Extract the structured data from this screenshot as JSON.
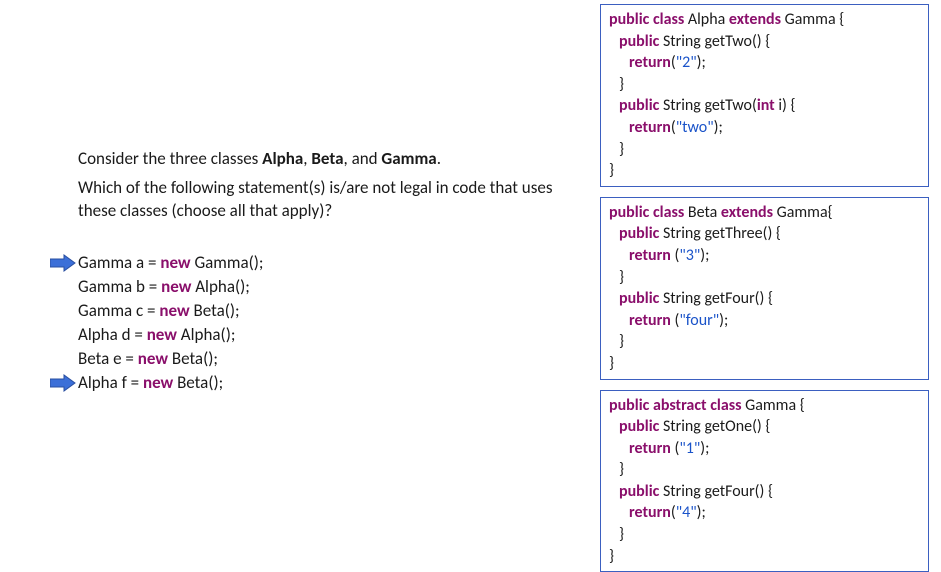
{
  "question": {
    "line1_pre": "Consider the three classes ",
    "c1": "Alpha",
    "sep1": ", ",
    "c2": "Beta",
    "sep2": ", and ",
    "c3": "Gamma",
    "line1_post": ".",
    "line2": "Which of the following statement(s) is/are not legal in code that uses these classes (choose all that apply)?"
  },
  "choices": [
    {
      "arrow": true,
      "lhsType": "Gamma",
      "var": "a",
      "rhsType": "Gamma"
    },
    {
      "arrow": false,
      "lhsType": "Gamma",
      "var": "b",
      "rhsType": "Alpha"
    },
    {
      "arrow": false,
      "lhsType": "Gamma",
      "var": "c",
      "rhsType": "Beta"
    },
    {
      "arrow": false,
      "lhsType": "Alpha",
      "var": "d",
      "rhsType": "Alpha"
    },
    {
      "arrow": false,
      "lhsType": "Beta",
      "var": "e",
      "rhsType": "Beta"
    },
    {
      "arrow": true,
      "lhsType": "Alpha",
      "var": "f",
      "rhsType": "Beta"
    }
  ],
  "kw": {
    "public": "public",
    "class": "class",
    "extends": "extends",
    "return": "return",
    "int": "int",
    "abstract": "abstract",
    "new": "new"
  },
  "types": {
    "String": "String"
  },
  "codeA": {
    "name": "Alpha",
    "super": "Gamma",
    "m1": {
      "name": "getTwo",
      "params": "",
      "ret": "\"2\""
    },
    "m2": {
      "name": "getTwo",
      "params_pre": "",
      "param_type": "int",
      "params_post": " i",
      "ret": "\"two\""
    }
  },
  "codeB": {
    "name": "Beta",
    "super": "Gamma",
    "m1": {
      "name": "getThree",
      "params": "",
      "ret": "\"3\""
    },
    "m2": {
      "name": "getFour",
      "params": "",
      "ret": "\"four\""
    }
  },
  "codeG": {
    "name": "Gamma",
    "m1": {
      "name": "getOne",
      "params": "",
      "ret": "\"1\""
    },
    "m2": {
      "name": "getFour",
      "params": "",
      "ret": "\"4\""
    }
  },
  "sym": {
    "space": " ",
    "obr": " {",
    "cbr": "}",
    "op": "(",
    "cp": ")",
    "eq": " = ",
    "semi": ";",
    "openparen_close": "() {",
    "open_brace_only": "{",
    "ret_open": "(",
    "ret_close": ");"
  }
}
